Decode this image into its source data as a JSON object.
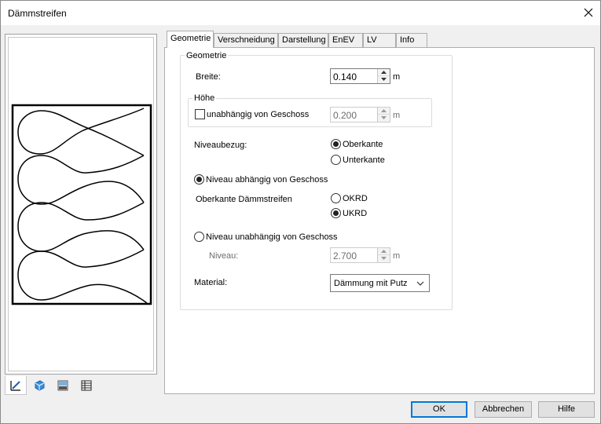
{
  "window": {
    "title": "Dämmstreifen"
  },
  "tabs": [
    {
      "label": "Geometrie",
      "active": true
    },
    {
      "label": "Verschneidung"
    },
    {
      "label": "Darstellung"
    },
    {
      "label": "EnEV"
    },
    {
      "label": "LV"
    },
    {
      "label": "Info"
    }
  ],
  "geometry": {
    "group_label": "Geometrie",
    "breite_label": "Breite:",
    "breite_value": "0.140",
    "breite_unit": "m",
    "hoehe": {
      "group_label": "Höhe",
      "checkbox_label": "unabhängig von Geschoss",
      "checked": false,
      "value": "0.200",
      "unit": "m"
    },
    "niveaubezug": {
      "label": "Niveaubezug:",
      "options": [
        "Oberkante",
        "Unterkante"
      ],
      "selected": "Oberkante"
    },
    "niveau_abhaengig": {
      "label": "Niveau abhängig von Geschoss",
      "selected": true,
      "oberkante_label": "Oberkante Dämmstreifen",
      "options": [
        "OKRD",
        "UKRD"
      ],
      "option_selected": "UKRD"
    },
    "niveau_unabhaengig": {
      "label": "Niveau unabhängig von Geschoss",
      "selected": false,
      "niveau_label": "Niveau:",
      "niveau_value": "2.700",
      "niveau_unit": "m"
    },
    "material": {
      "label": "Material:",
      "value": "Dämmung mit Putz"
    }
  },
  "view_toolbar": [
    "edit-view-icon",
    "3d-view-icon",
    "bitmap-view-icon",
    "table-view-icon"
  ],
  "buttons": {
    "ok": "OK",
    "cancel": "Abbrechen",
    "help": "Hilfe"
  },
  "colors": {
    "accent": "#0078d7",
    "panel": "#f0f0f0"
  }
}
